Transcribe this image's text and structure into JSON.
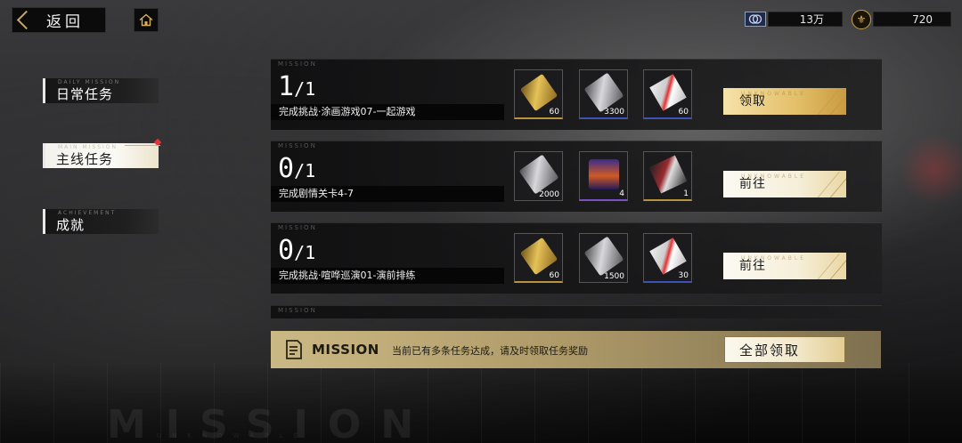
{
  "header": {
    "back_label": "返回",
    "home_icon": "home-icon"
  },
  "currencies": [
    {
      "icon": "silver-coin-icon",
      "value": "13万"
    },
    {
      "icon": "fleur-coin-icon",
      "value": "720"
    }
  ],
  "tabs": [
    {
      "sub": "DAILY MISSION",
      "label": "日常任务",
      "active": false
    },
    {
      "sub": "MAIN MISSION",
      "label": "主线任务",
      "active": true,
      "badge": true
    },
    {
      "sub": "ACHIEVEMENT",
      "label": "成就",
      "active": false
    }
  ],
  "missions": [
    {
      "tag": "MISSION",
      "progress_current": "1",
      "progress_total": "1",
      "description": "完成挑战·涂画游戏07-一起游戏",
      "rewards": [
        {
          "icon": "gold-bar-icon",
          "count": "60"
        },
        {
          "icon": "silver-ticket-icon",
          "count": "3300"
        },
        {
          "icon": "supply-pack-icon",
          "count": "60"
        }
      ],
      "button_label": "领取",
      "button_watermark": "UNKNOWABLE"
    },
    {
      "tag": "MISSION",
      "progress_current": "0",
      "progress_total": "1",
      "description": "完成剧情关卡4-7",
      "rewards": [
        {
          "icon": "silver-ticket-icon",
          "count": "2000"
        },
        {
          "icon": "energy-drink-icon",
          "count": "4"
        },
        {
          "icon": "character-card-icon",
          "count": "1"
        }
      ],
      "button_label": "前往",
      "button_watermark": "UNKNOWABLE"
    },
    {
      "tag": "MISSION",
      "progress_current": "0",
      "progress_total": "1",
      "description": "完成挑战·喧哗巡演01-演前排练",
      "rewards": [
        {
          "icon": "gold-bar-icon",
          "count": "60"
        },
        {
          "icon": "silver-ticket-icon",
          "count": "1500"
        },
        {
          "icon": "supply-pack-icon",
          "count": "30"
        }
      ],
      "button_label": "前往",
      "button_watermark": "UNKNOWABLE"
    },
    {
      "tag": "MISSION"
    }
  ],
  "claim_bar": {
    "title": "MISSION",
    "message": "当前已有多条任务达成，请及时领取任务奖励",
    "button_label": "全部领取"
  },
  "footer": {
    "watermark": "MISSION",
    "sub": "UNKNOWABLE"
  }
}
